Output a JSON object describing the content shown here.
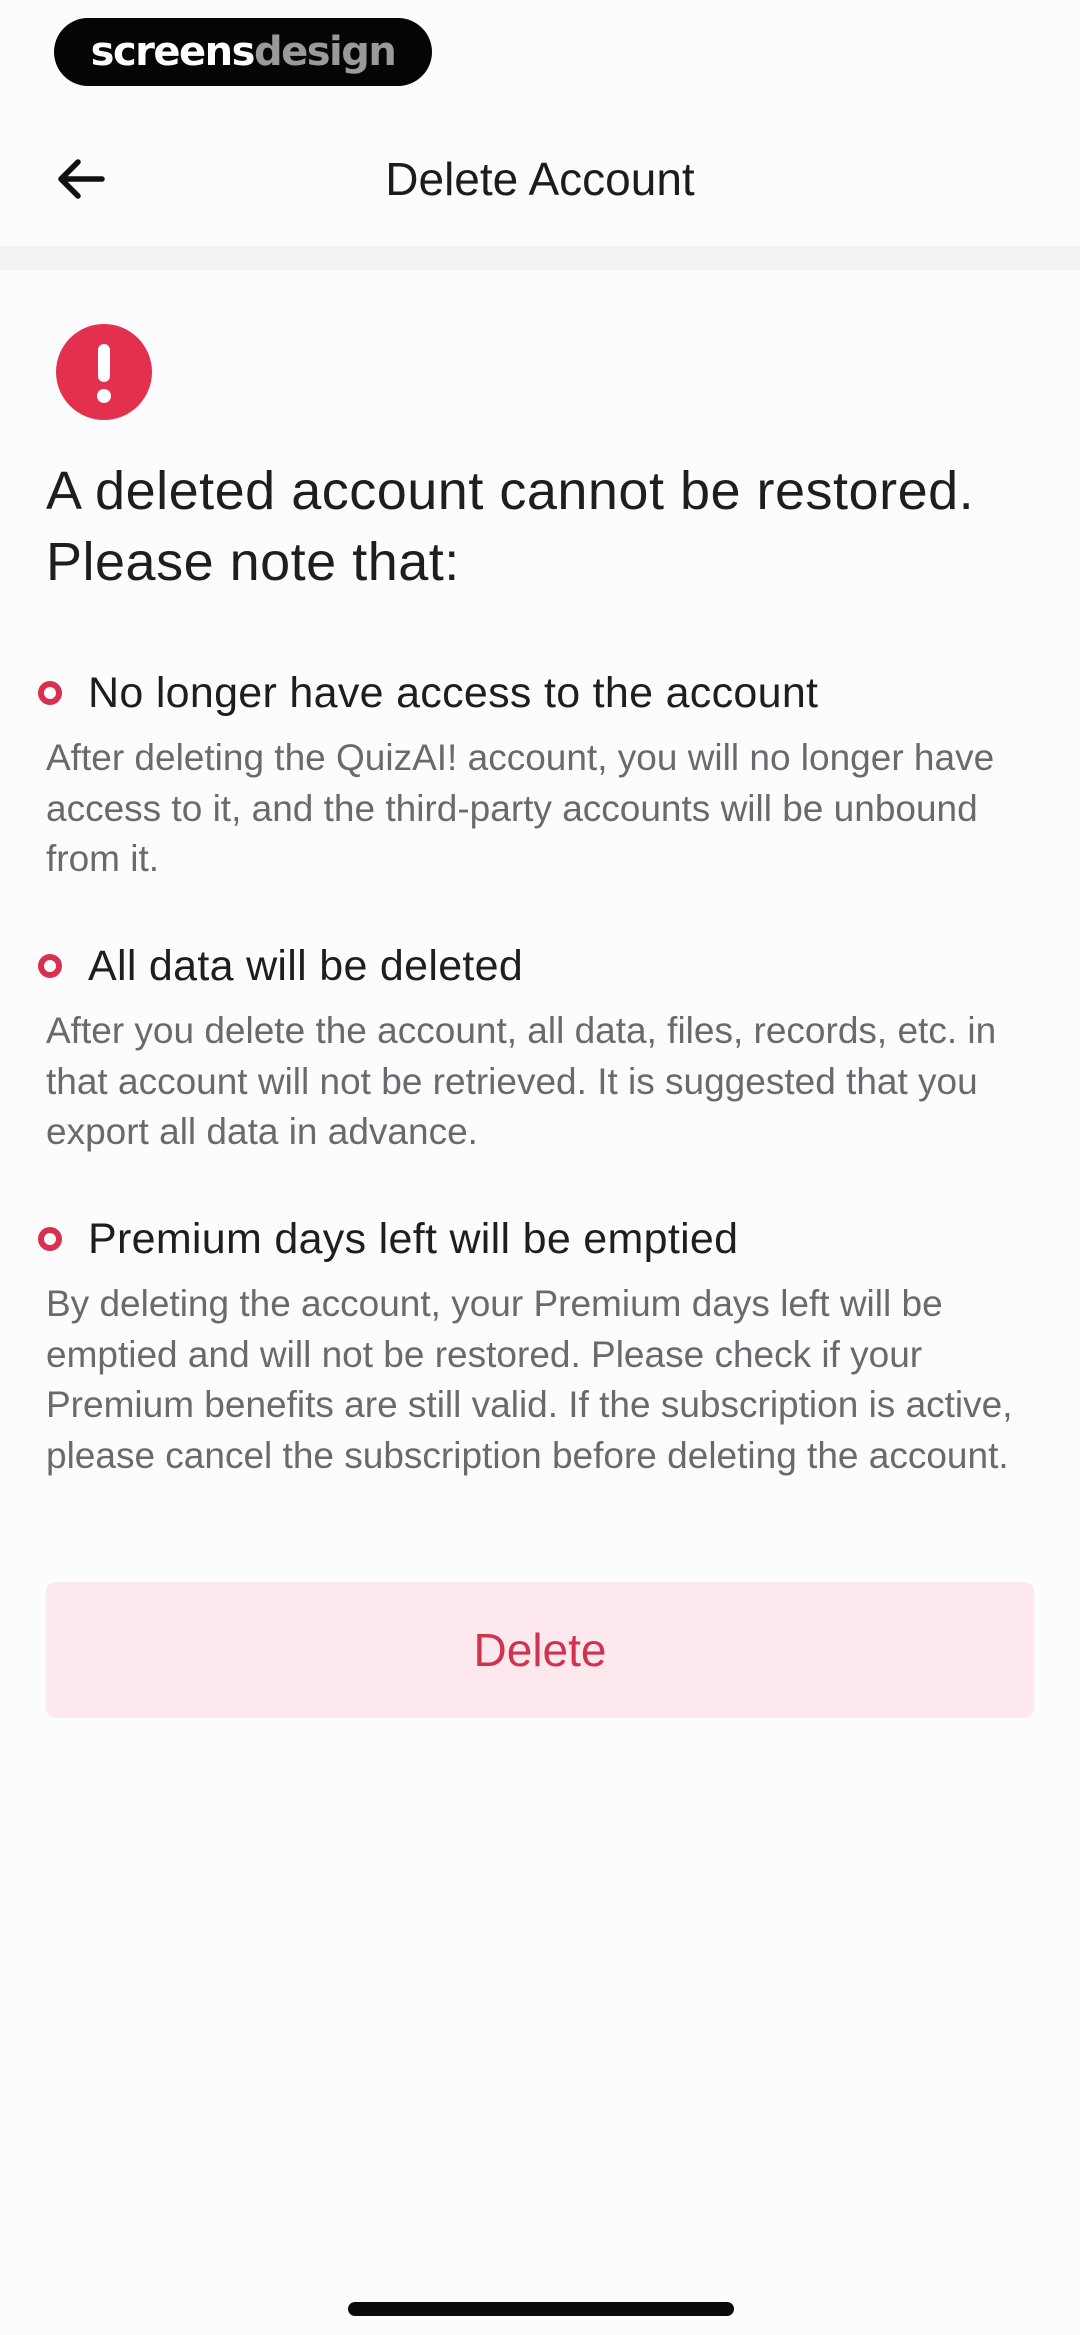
{
  "brand": {
    "part1": "screens",
    "part2": "design"
  },
  "header": {
    "title": "Delete Account"
  },
  "warning": {
    "title": "A deleted account cannot be restored. Please note that:"
  },
  "items": [
    {
      "title": "No longer have access to the account",
      "description": "After deleting the QuizAI! account, you will no longer have access to it, and the third-party accounts will be unbound from it."
    },
    {
      "title": "All data will be deleted",
      "description": "After you delete the account, all data, files, records, etc. in that account will not be retrieved. It is suggested that you export all data in advance."
    },
    {
      "title": "Premium days left will be emptied",
      "description": "By deleting the account, your Premium days left will be emptied and will not be restored. Please check if your Premium benefits are still valid. If the subscription is active, please cancel the subscription before deleting the account."
    }
  ],
  "actions": {
    "delete_label": "Delete"
  },
  "icons": {
    "back": "arrow-left-icon",
    "alert": "exclamation-circle-icon",
    "bullet": "ring-bullet-icon"
  },
  "colors": {
    "accent": "#d9304f",
    "button_bg": "#fce8ed",
    "button_text": "#d03351"
  }
}
